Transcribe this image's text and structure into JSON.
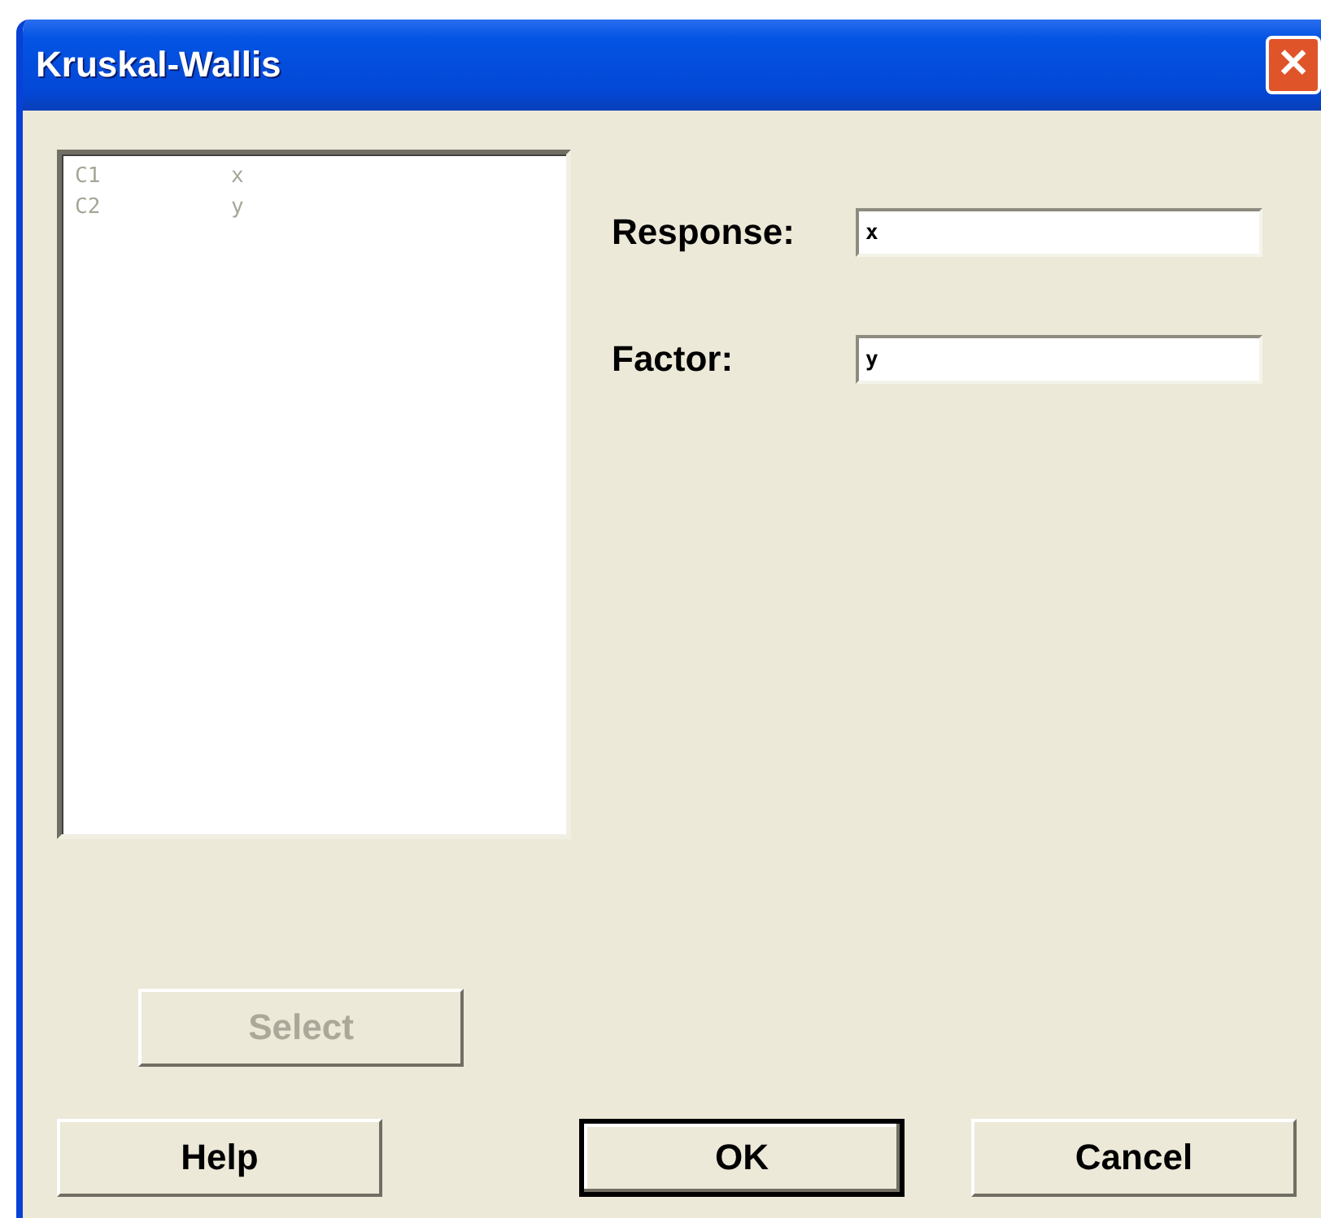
{
  "window": {
    "title": "Kruskal-Wallis",
    "close_label": "✕"
  },
  "variables": {
    "disabled": true,
    "items": [
      {
        "column": "C1",
        "name": "x"
      },
      {
        "column": "C2",
        "name": "y"
      }
    ]
  },
  "fields": [
    {
      "label": "Response:",
      "value": "x"
    },
    {
      "label": "Factor:",
      "value": "y"
    }
  ],
  "select_button": {
    "label": "Select",
    "disabled": true
  },
  "buttons": [
    {
      "label": "Help",
      "default": false
    },
    {
      "label": "OK",
      "default": true
    },
    {
      "label": "Cancel",
      "default": false
    }
  ]
}
